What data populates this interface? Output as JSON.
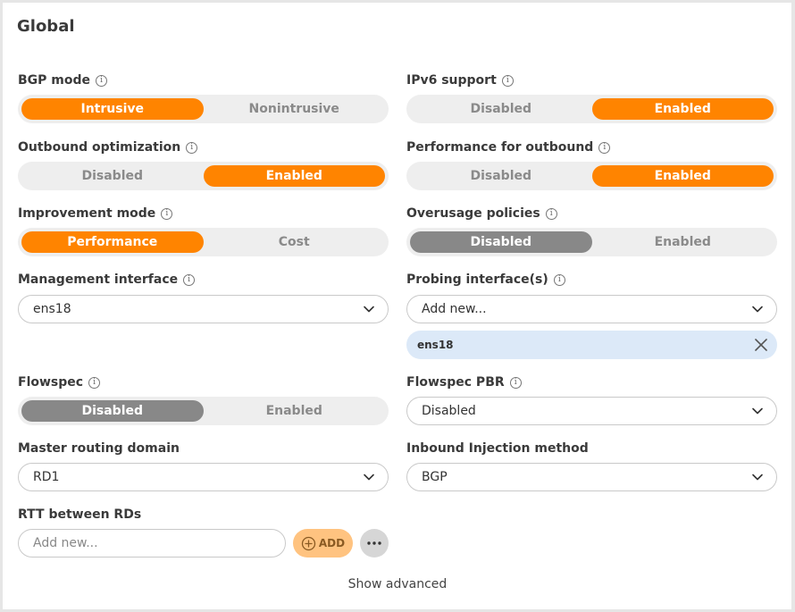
{
  "title": "Global",
  "info_glyph": "i",
  "bgp_mode": {
    "label": "BGP mode",
    "options": [
      "Intrusive",
      "Nonintrusive"
    ],
    "selected": "Intrusive"
  },
  "ipv6_support": {
    "label": "IPv6 support",
    "options": [
      "Disabled",
      "Enabled"
    ],
    "selected": "Enabled"
  },
  "outbound_optimization": {
    "label": "Outbound optimization",
    "options": [
      "Disabled",
      "Enabled"
    ],
    "selected": "Enabled"
  },
  "performance_for_outbound": {
    "label": "Performance for outbound",
    "options": [
      "Disabled",
      "Enabled"
    ],
    "selected": "Enabled"
  },
  "improvement_mode": {
    "label": "Improvement mode",
    "options": [
      "Performance",
      "Cost"
    ],
    "selected": "Performance"
  },
  "overusage_policies": {
    "label": "Overusage policies",
    "options": [
      "Disabled",
      "Enabled"
    ],
    "selected": "Disabled"
  },
  "management_interface": {
    "label": "Management interface",
    "value": "ens18"
  },
  "probing_interfaces": {
    "label": "Probing interface(s)",
    "placeholder": "Add new...",
    "tags": [
      "ens18"
    ]
  },
  "flowspec": {
    "label": "Flowspec",
    "options": [
      "Disabled",
      "Enabled"
    ],
    "selected": "Disabled"
  },
  "flowspec_pbr": {
    "label": "Flowspec PBR",
    "value": "Disabled"
  },
  "master_routing_domain": {
    "label": "Master routing domain",
    "value": "RD1"
  },
  "inbound_injection_method": {
    "label": "Inbound Injection method",
    "value": "BGP"
  },
  "rtt_between_rds": {
    "label": "RTT between RDs",
    "placeholder": "Add new...",
    "add_label": "ADD"
  },
  "show_advanced": "Show advanced",
  "colors": {
    "accent": "#ff8400",
    "neutral_selected": "#888888",
    "tag_bg": "#dce9f8",
    "add_button_bg": "#ffc380"
  },
  "icons": {
    "info": "info-icon",
    "dropdown": "chevron-down-icon",
    "remove": "close-icon",
    "add": "plus-circle-icon",
    "more": "more-icon"
  }
}
